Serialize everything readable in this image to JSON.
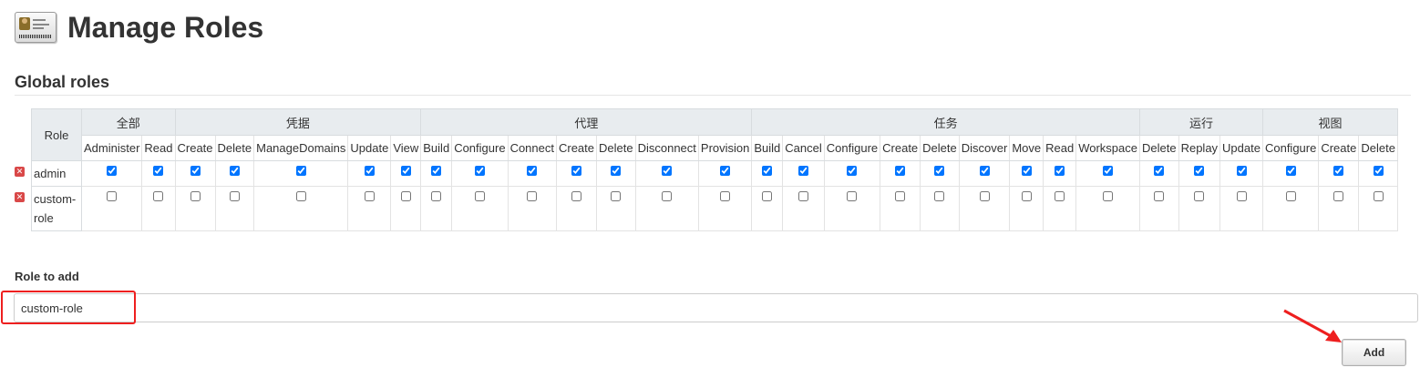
{
  "page": {
    "title": "Manage Roles",
    "section_title": "Global roles"
  },
  "table": {
    "role_header": "Role",
    "categories": [
      {
        "name": "全部",
        "perms": [
          "Administer",
          "Read"
        ]
      },
      {
        "name": "凭据",
        "perms": [
          "Create",
          "Delete",
          "ManageDomains",
          "Update",
          "View"
        ]
      },
      {
        "name": "代理",
        "perms": [
          "Build",
          "Configure",
          "Connect",
          "Create",
          "Delete",
          "Disconnect",
          "Provision"
        ]
      },
      {
        "name": "任务",
        "perms": [
          "Build",
          "Cancel",
          "Configure",
          "Create",
          "Delete",
          "Discover",
          "Move",
          "Read",
          "Workspace"
        ]
      },
      {
        "name": "运行",
        "perms": [
          "Delete",
          "Replay",
          "Update"
        ]
      },
      {
        "name": "视图",
        "perms": [
          "Configure",
          "Create",
          "Delete"
        ]
      }
    ],
    "roles": [
      {
        "name": "admin",
        "checked": true
      },
      {
        "name": "custom-role",
        "checked": false
      }
    ]
  },
  "add_role": {
    "label": "Role to add",
    "input_value": "custom-role",
    "button_label": "Add"
  },
  "colors": {
    "highlight": "#ee1f1f",
    "header_bg": "#e8ecef",
    "delete_icon": "#d94848"
  },
  "icons": {
    "page_icon": "id-card-icon",
    "delete_role": "delete-icon"
  }
}
